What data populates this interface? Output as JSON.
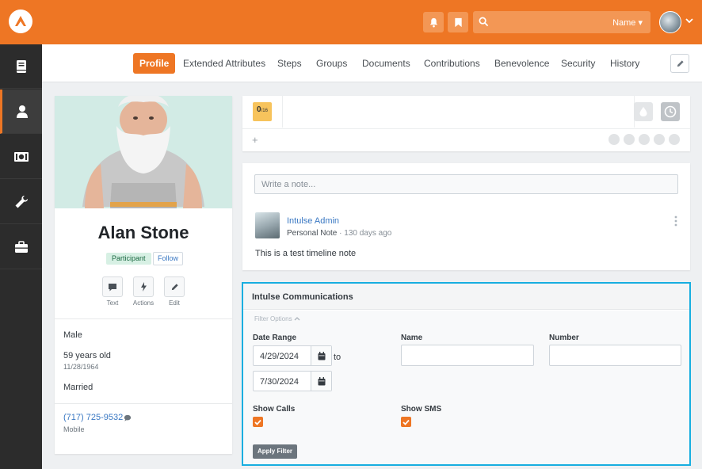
{
  "header": {
    "search_scope": "Name",
    "colors": {
      "brand": "#ee7624",
      "sidebar": "#2c2c2c",
      "focus": "#17aee0"
    }
  },
  "sidebar": {
    "items": [
      {
        "icon": "book-icon"
      },
      {
        "icon": "person-icon",
        "active": true
      },
      {
        "icon": "money-icon"
      },
      {
        "icon": "wrench-icon"
      },
      {
        "icon": "briefcase-icon"
      }
    ]
  },
  "tabs": [
    "Profile",
    "Extended Attributes",
    "Steps",
    "Groups",
    "Documents",
    "Contributions",
    "Benevolence",
    "Security",
    "History"
  ],
  "profile": {
    "name": "Alan Stone",
    "badge": "Participant",
    "follow_label": "Follow",
    "actions": [
      "Text",
      "Actions",
      "Edit"
    ],
    "gender": "Male",
    "age": "59 years old",
    "birthdate": "11/28/1964",
    "marital_status": "Married",
    "phone": "(717) 725-9532",
    "phone_type": "Mobile"
  },
  "badges": {
    "score": "0",
    "score_total": "/16"
  },
  "notes": {
    "placeholder": "Write a note...",
    "author": "Intulse Admin",
    "note_type": "Personal Note",
    "note_age": "· 130 days ago",
    "text": "This is a test timeline note"
  },
  "communications": {
    "title": "Intulse Communications",
    "filter_toggle": "Filter Options",
    "date_range_label": "Date Range",
    "date_from": "4/29/2024",
    "to_label": "to",
    "date_to": "7/30/2024",
    "name_label": "Name",
    "number_label": "Number",
    "show_calls_label": "Show Calls",
    "show_calls": true,
    "show_sms_label": "Show SMS",
    "show_sms": true,
    "apply_label": "Apply Filter"
  }
}
